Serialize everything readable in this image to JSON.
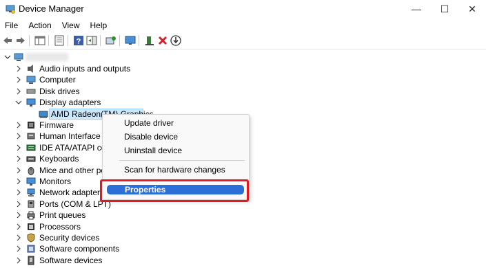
{
  "window": {
    "title": "Device Manager",
    "minimize_glyph": "—",
    "maximize_glyph": "☐",
    "close_glyph": "✕"
  },
  "menu": [
    "File",
    "Action",
    "View",
    "Help"
  ],
  "tree": {
    "categories": [
      {
        "label": "Audio inputs and outputs",
        "icon": "speaker-icon",
        "expanded": false
      },
      {
        "label": "Computer",
        "icon": "computer-icon",
        "expanded": false
      },
      {
        "label": "Disk drives",
        "icon": "disk-drive-icon",
        "expanded": false
      },
      {
        "label": "Display adapters",
        "icon": "monitor-icon",
        "expanded": true
      },
      {
        "label": "AMD Radeon(TM) Graphics",
        "icon": "display-card-icon",
        "child": true,
        "selected": true
      },
      {
        "label": "Firmware",
        "icon": "firmware-icon",
        "expanded": false
      },
      {
        "label": "Human Interface D",
        "icon": "hid-icon",
        "expanded": false
      },
      {
        "label": "IDE ATA/ATAPI con",
        "icon": "ide-controller-icon",
        "expanded": false
      },
      {
        "label": "Keyboards",
        "icon": "keyboard-icon",
        "expanded": false
      },
      {
        "label": "Mice and other po",
        "icon": "mouse-icon",
        "expanded": false
      },
      {
        "label": "Monitors",
        "icon": "monitor-icon",
        "expanded": false
      },
      {
        "label": "Network adapters",
        "icon": "network-icon",
        "expanded": false
      },
      {
        "label": "Ports (COM & LPT)",
        "icon": "port-icon",
        "expanded": false
      },
      {
        "label": "Print queues",
        "icon": "printer-icon",
        "expanded": false
      },
      {
        "label": "Processors",
        "icon": "processor-icon",
        "expanded": false
      },
      {
        "label": "Security devices",
        "icon": "security-icon",
        "expanded": false
      },
      {
        "label": "Software components",
        "icon": "software-component-icon",
        "expanded": false
      },
      {
        "label": "Software devices",
        "icon": "software-device-icon",
        "expanded": false
      }
    ]
  },
  "context_menu": {
    "items": [
      "Update driver",
      "Disable device",
      "Uninstall device",
      "Scan for hardware changes"
    ],
    "highlighted": "Properties"
  },
  "colors": {
    "menu_highlight": "#2c6fd6",
    "annotation_box": "#e01b22",
    "selection_bg": "#cce8ff"
  }
}
